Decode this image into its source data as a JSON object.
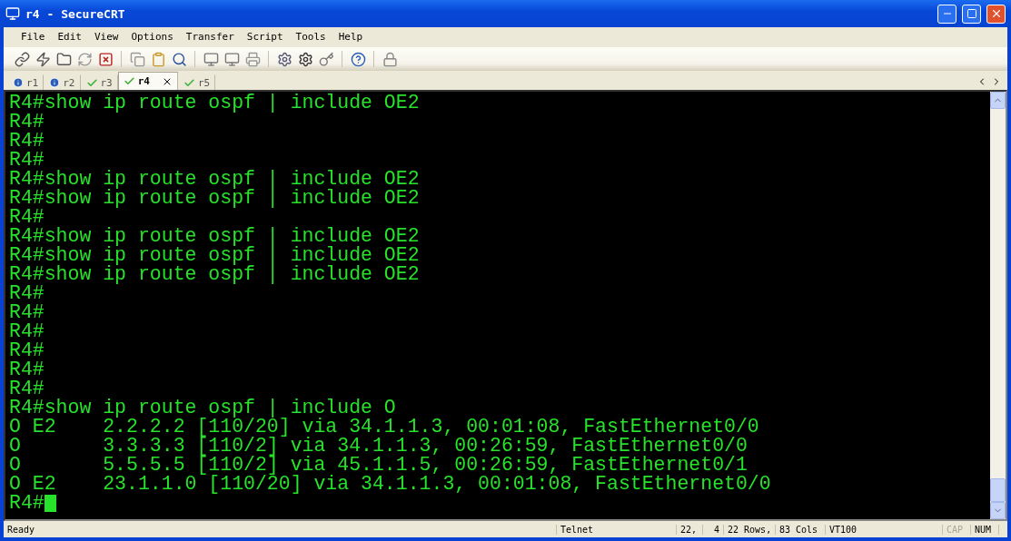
{
  "window": {
    "title": "r4 - SecureCRT"
  },
  "menu": [
    "File",
    "Edit",
    "View",
    "Options",
    "Transfer",
    "Script",
    "Tools",
    "Help"
  ],
  "tabs": [
    {
      "label": "r1",
      "kind": "info",
      "selected": false
    },
    {
      "label": "r2",
      "kind": "info",
      "selected": false
    },
    {
      "label": "r3",
      "kind": "check",
      "selected": false
    },
    {
      "label": "r4",
      "kind": "check",
      "selected": true
    },
    {
      "label": "r5",
      "kind": "check",
      "selected": false
    }
  ],
  "terminal": {
    "lines": [
      "R4#show ip route ospf | include OE2",
      "R4#",
      "R4#",
      "R4#",
      "R4#show ip route ospf | include OE2",
      "R4#show ip route ospf | include OE2",
      "R4#",
      "R4#show ip route ospf | include OE2",
      "R4#show ip route ospf | include OE2",
      "R4#show ip route ospf | include OE2",
      "R4#",
      "R4#",
      "R4#",
      "R4#",
      "R4#",
      "R4#",
      "R4#show ip route ospf | include O",
      "O E2    2.2.2.2 [110/20] via 34.1.1.3, 00:01:08, FastEthernet0/0",
      "O       3.3.3.3 [110/2] via 34.1.1.3, 00:26:59, FastEthernet0/0",
      "O       5.5.5.5 [110/2] via 45.1.1.5, 00:26:59, FastEthernet0/1",
      "O E2    23.1.1.0 [110/20] via 34.1.1.3, 00:01:08, FastEthernet0/0",
      "R4#"
    ],
    "cursor": true
  },
  "status_bar": {
    "message": "Ready",
    "protocol": "Telnet",
    "row": "22,",
    "col": "4",
    "rows": "22 Rows,",
    "cols": "83 Cols",
    "emulation": "VT100",
    "caps": {
      "label": "CAP",
      "on": false
    },
    "num": {
      "label": "NUM",
      "on": true
    }
  }
}
